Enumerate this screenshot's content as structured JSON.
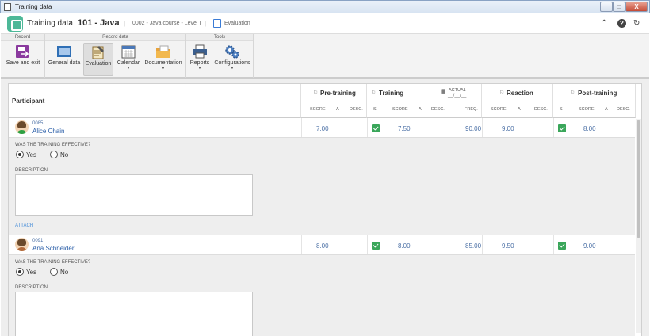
{
  "window": {
    "title": "Training data",
    "buttons": [
      "_",
      "□",
      "X"
    ]
  },
  "header": {
    "title": "Training data",
    "separator": "›",
    "code": "101 - Java",
    "course": "0002 - Java course - Level I",
    "section": "Evaluation",
    "right_icons": [
      "collapse-icon",
      "help-icon",
      "refresh-icon"
    ]
  },
  "ribbon": {
    "groups": [
      {
        "title": "Record",
        "buttons": [
          {
            "label": "Save and exit",
            "icon": "save-exit-icon"
          }
        ]
      },
      {
        "title": "Record data",
        "buttons": [
          {
            "label": "General data",
            "icon": "general-data-icon"
          },
          {
            "label": "Evaluation",
            "icon": "evaluation-icon",
            "active": true
          },
          {
            "label": "Calendar",
            "icon": "calendar-icon",
            "dropdown": true
          },
          {
            "label": "Documentation",
            "icon": "folder-icon",
            "dropdown": true
          }
        ]
      },
      {
        "title": "Tools",
        "buttons": [
          {
            "label": "Reports",
            "icon": "printer-icon",
            "dropdown": true
          },
          {
            "label": "Configurations",
            "icon": "gears-icon",
            "dropdown": true
          }
        ]
      }
    ]
  },
  "grid": {
    "participant_header": "Participant",
    "groups": {
      "pre_training": {
        "label": "Pre-training",
        "subs": [
          "SCORE",
          "A",
          "DESC."
        ]
      },
      "training": {
        "label": "Training",
        "actual_label": "ACTUAL",
        "actual_value": "__/__/__",
        "subs": [
          "S",
          "SCORE",
          "A",
          "DESC.",
          "FREQ."
        ]
      },
      "reaction": {
        "label": "Reaction",
        "subs": [
          "SCORE",
          "A",
          "DESC."
        ]
      },
      "post_training": {
        "label": "Post-training",
        "subs": [
          "S",
          "SCORE",
          "A",
          "DESC."
        ]
      }
    },
    "rows": [
      {
        "id": "0085",
        "name": "Alice Chain",
        "pre_score": "7.00",
        "training_score": "7.50",
        "freq": "90.00",
        "reaction_score": "9.00",
        "post_score": "8.00",
        "question": "WAS THE TRAINING EFFECTIVE?",
        "yes": "Yes",
        "no": "No",
        "desc_label": "DESCRIPTION",
        "attach": "ATTACH"
      },
      {
        "id": "0091",
        "name": "Ana Schneider",
        "pre_score": "8.00",
        "training_score": "8.00",
        "freq": "85.00",
        "reaction_score": "9.50",
        "post_score": "9.00",
        "question": "WAS THE TRAINING EFFECTIVE?",
        "yes": "Yes",
        "no": "No",
        "desc_label": "DESCRIPTION"
      }
    ]
  },
  "colors": {
    "accent": "#4db898",
    "link": "#2a5ea8",
    "check": "#3aa65a"
  }
}
